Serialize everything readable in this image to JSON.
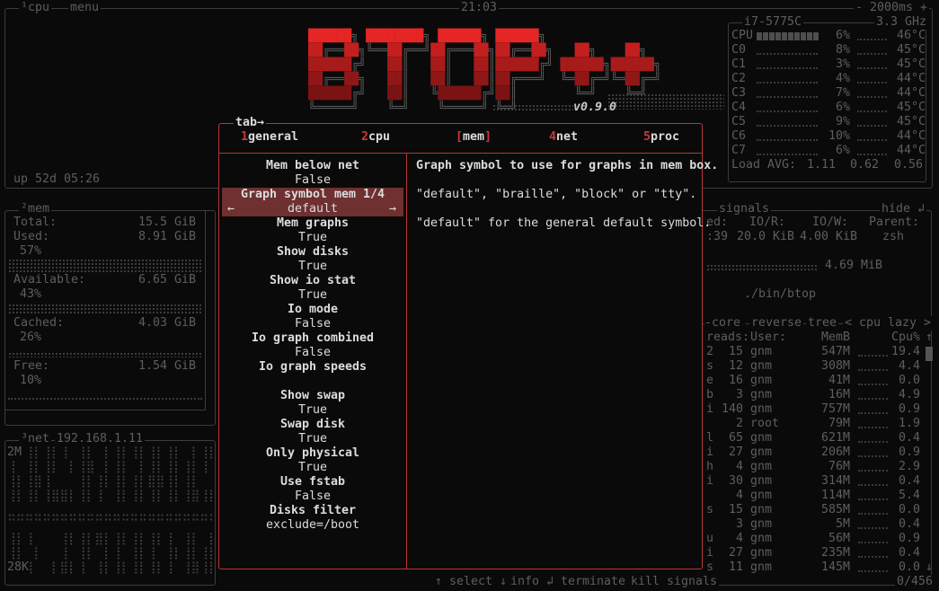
{
  "colors": {
    "accent": "#c83a3a",
    "selected_bg": "#6e3030",
    "border": "#3c3c3c",
    "text_dim": "#5e5e5e",
    "text": "#dcdcdc",
    "logo_rows": [
      "#e62525",
      "#c41f1f",
      "#a81b1b",
      "#901717",
      "#7c1313",
      "#555555"
    ]
  },
  "cpu_box": {
    "title_num": "¹",
    "title": "cpu",
    "menu_label": "menu",
    "clock": "21:03",
    "interval": "- 2000ms +",
    "uptime": "up 52d 05:26",
    "model": "i7-5775C",
    "freq": "3.3 GHz",
    "rows": [
      {
        "label": "CPU",
        "pct": "6%",
        "temp": "46°C"
      },
      {
        "label": "C0",
        "pct": "8%",
        "temp": "45°C"
      },
      {
        "label": "C1",
        "pct": "3%",
        "temp": "45°C"
      },
      {
        "label": "C2",
        "pct": "4%",
        "temp": "44°C"
      },
      {
        "label": "C3",
        "pct": "7%",
        "temp": "44°C"
      },
      {
        "label": "C4",
        "pct": "6%",
        "temp": "45°C"
      },
      {
        "label": "C5",
        "pct": "9%",
        "temp": "45°C"
      },
      {
        "label": "C6",
        "pct": "10%",
        "temp": "44°C"
      },
      {
        "label": "C7",
        "pct": "6%",
        "temp": "44°C"
      }
    ],
    "load_label": "Load AVG:",
    "load": [
      "1.11",
      "0.62",
      "0.56"
    ]
  },
  "logo": [
    "██████╗ ████████╗ ██████╗ ██████╗",
    "██╔══██╗╚══██╔══╝██╔═══██╗██╔══██╗   ██╗    ██╗",
    "██████╔╝   ██║   ██║   ██║██████╔╝ ██████╗██████╗",
    "██╔══██╗   ██║   ██║   ██║██╔═══╝  ╚═██╔═╝╚═██╔═╝",
    "██████╔╝   ██║   ╚██████╔╝██║        ╚═╝    ╚═╝",
    "╚═════╝    ╚═╝    ╚═════╝ ╚═╝"
  ],
  "version": "v0.9.0",
  "mem_box": {
    "title_num": "²",
    "title": "mem",
    "total_label": "Total:",
    "total": "15.5 GiB",
    "used_label": "Used:",
    "used": "8.91 GiB",
    "used_pct": "57%",
    "avail_label": "Available:",
    "avail": "6.65 GiB",
    "avail_pct": "43%",
    "cached_label": "Cached:",
    "cached": "4.03 GiB",
    "cached_pct": "26%",
    "free_label": "Free:",
    "free": "1.54 GiB",
    "free_pct": "10%"
  },
  "net_box": {
    "title_num": "³",
    "title": "net",
    "ip": "192.168.1.11",
    "top_scale": "2M",
    "bottom_scale": "28K"
  },
  "proc_box": {
    "signals": "signals",
    "hide": "hide ↲",
    "detail_headers": [
      "ed:",
      "IO/R:",
      "IO/W:",
      "Parent:"
    ],
    "detail_values": [
      ":39",
      "20.0 KiB",
      "4.00 KiB",
      "zsh"
    ],
    "mem_value": "4.69 MiB",
    "cmd": "./bin/btop",
    "sort": {
      "core": "-core",
      "reverse": "reverse",
      "tree": "tree",
      "sort_sel": "< cpu lazy >"
    },
    "headers": {
      "threads": "reads:",
      "user": "User:",
      "mem": "MemB",
      "cpu": "Cpu%"
    },
    "rows": [
      {
        "c": "2",
        "t": "15",
        "u": "gnm",
        "m": "547M",
        "p": "19.4"
      },
      {
        "c": "s",
        "t": "12",
        "u": "gnm",
        "m": "308M",
        "p": "4.4"
      },
      {
        "c": "e",
        "t": "16",
        "u": "gnm",
        "m": "41M",
        "p": "0.0"
      },
      {
        "c": "b",
        "t": "3",
        "u": "gnm",
        "m": "16M",
        "p": "4.9"
      },
      {
        "c": "i",
        "t": "140",
        "u": "gnm",
        "m": "757M",
        "p": "0.9"
      },
      {
        "c": "",
        "t": "2",
        "u": "root",
        "m": "79M",
        "p": "1.9"
      },
      {
        "c": "l",
        "t": "65",
        "u": "gnm",
        "m": "621M",
        "p": "0.4"
      },
      {
        "c": "i",
        "t": "27",
        "u": "gnm",
        "m": "206M",
        "p": "0.9"
      },
      {
        "c": "h",
        "t": "4",
        "u": "gnm",
        "m": "76M",
        "p": "2.9"
      },
      {
        "c": "i",
        "t": "30",
        "u": "gnm",
        "m": "314M",
        "p": "0.4"
      },
      {
        "c": "",
        "t": "4",
        "u": "gnm",
        "m": "114M",
        "p": "5.4"
      },
      {
        "c": "s",
        "t": "15",
        "u": "gnm",
        "m": "585M",
        "p": "0.0"
      },
      {
        "c": "",
        "t": "3",
        "u": "gnm",
        "m": "5M",
        "p": "0.4"
      },
      {
        "c": "u",
        "t": "4",
        "u": "gnm",
        "m": "56M",
        "p": "0.9"
      },
      {
        "c": "i",
        "t": "27",
        "u": "gnm",
        "m": "235M",
        "p": "0.4"
      },
      {
        "c": "s",
        "t": "11",
        "u": "gnm",
        "m": "145M",
        "p": "0.0"
      }
    ],
    "count": "0/456",
    "footer": {
      "select": "↑ select ↓",
      "info": "info ↲",
      "terminate": "terminate",
      "kill": "kill",
      "signals": "signals"
    }
  },
  "menu": {
    "tab_hint": "tab→",
    "tabs": [
      {
        "num": "1",
        "label": "general"
      },
      {
        "num": "2",
        "label": "cpu"
      },
      {
        "label": "mem",
        "selected": true
      },
      {
        "num": "4",
        "label": "net"
      },
      {
        "num": "5",
        "label": "proc"
      }
    ],
    "options": [
      {
        "label": "Mem below net",
        "value": "False"
      },
      {
        "label": "Graph symbol mem 1/4",
        "value": "default",
        "selected": true
      },
      {
        "label": "Mem graphs",
        "value": "True"
      },
      {
        "label": "Show disks",
        "value": "True"
      },
      {
        "label": "Show io stat",
        "value": "True"
      },
      {
        "label": "Io mode",
        "value": "False"
      },
      {
        "label": "Io graph combined",
        "value": "False"
      },
      {
        "label": "Io graph speeds",
        "value": ""
      },
      {
        "label": "Show swap",
        "value": "True"
      },
      {
        "label": "Swap disk",
        "value": "True"
      },
      {
        "label": "Only physical",
        "value": "True"
      },
      {
        "label": "Use fstab",
        "value": "False"
      },
      {
        "label": "Disks filter",
        "value": "exclude=/boot"
      }
    ],
    "description": [
      "Graph symbol to use for graphs in mem box.",
      "\"default\", \"braille\", \"block\" or \"tty\".",
      "\"default\" for the general default symbol."
    ]
  }
}
